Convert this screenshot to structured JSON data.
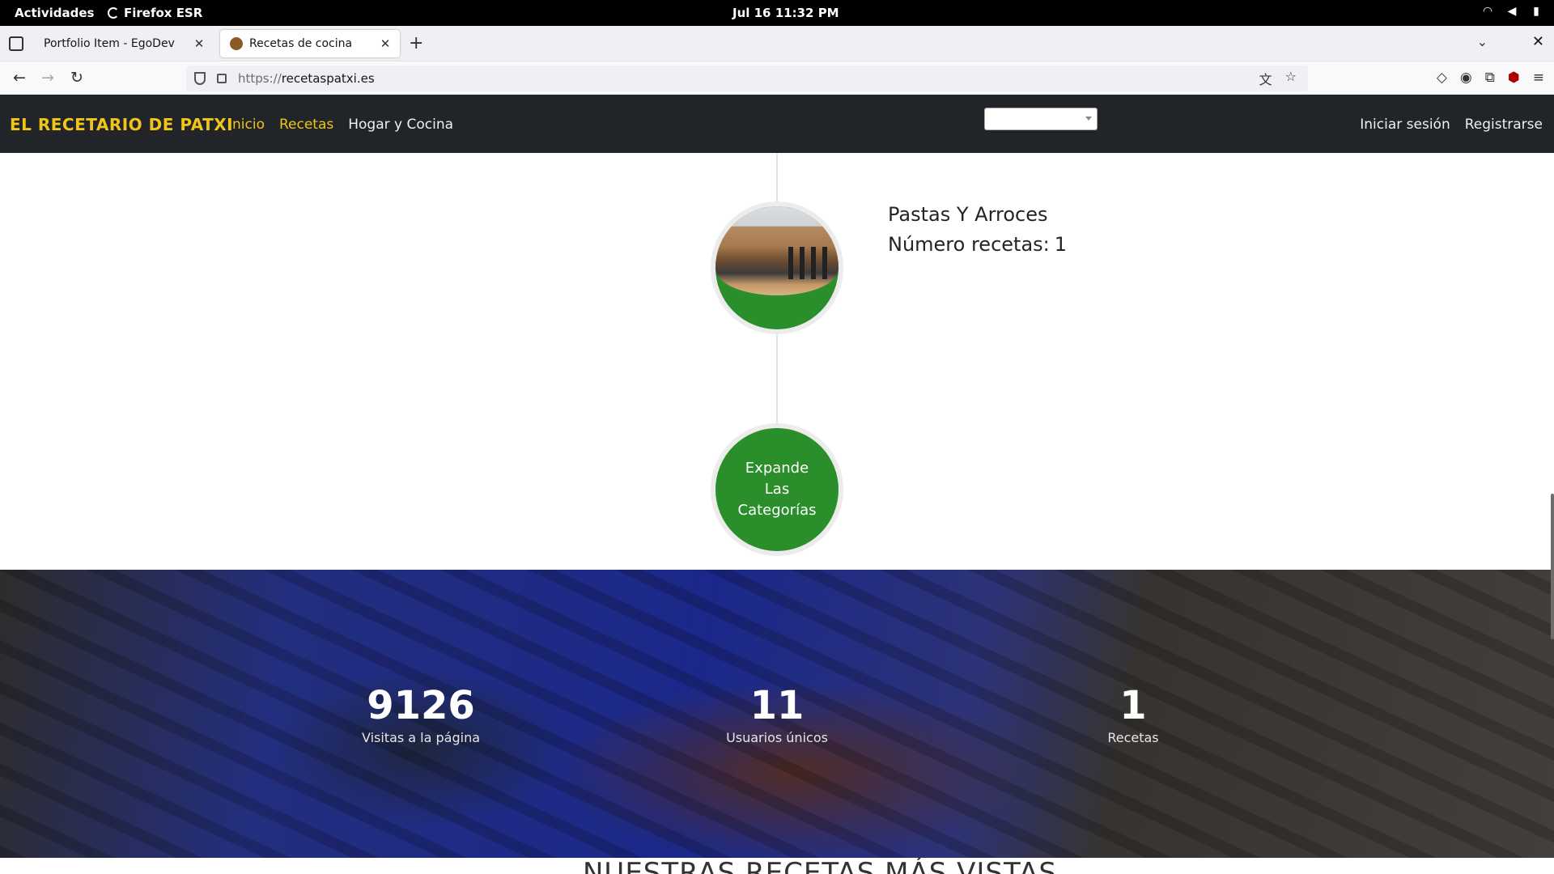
{
  "system": {
    "activities": "Actividades",
    "app_name": "Firefox ESR",
    "clock": "Jul 16  11:32 PM"
  },
  "tabs": [
    {
      "label": "Portfolio Item - EgoDev"
    },
    {
      "label": "Recetas de cocina"
    }
  ],
  "address": {
    "scheme": "https://",
    "host": "recetaspatxi.es"
  },
  "site": {
    "brand": "EL RECETARIO DE PATXI",
    "nav": [
      "Inicio",
      "Recetas",
      "Hogar y Cocina"
    ],
    "auth": [
      "Iniciar sesión",
      "Registrarse"
    ]
  },
  "category": {
    "name": "Pastas Y Arroces",
    "count_label": "Número recetas:",
    "count": "1"
  },
  "expand_button": "Expande Las Categorías",
  "stats": [
    {
      "value": "9126",
      "label": "Visitas a la página"
    },
    {
      "value": "11",
      "label": "Usuarios únicos"
    },
    {
      "value": "1",
      "label": "Recetas"
    }
  ],
  "next_section_title": "NUESTRAS RECETAS MÁS VISTAS",
  "colors": {
    "brand_yellow": "#f0c419",
    "header_bg": "#212529",
    "node_green": "#2a8f2a"
  }
}
